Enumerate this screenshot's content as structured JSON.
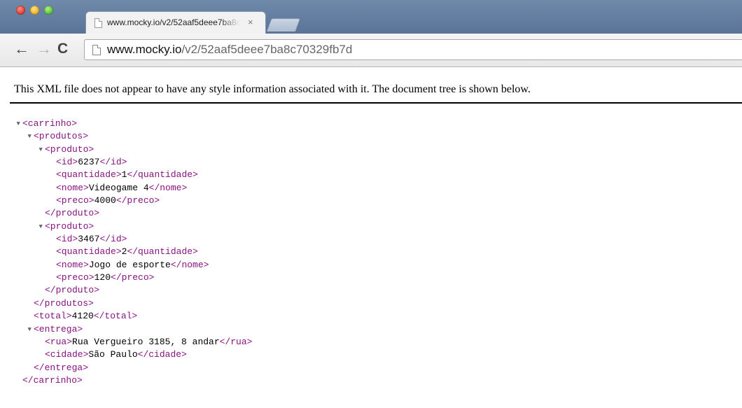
{
  "tab": {
    "title": "www.mocky.io/v2/52aaf5deee7ba8c70329fb7d",
    "close": "×"
  },
  "toolbar": {
    "back": "←",
    "forward": "→",
    "reload": "C"
  },
  "omnibox": {
    "host": "www.mocky.io",
    "path": "/v2/52aaf5deee7ba8c70329fb7d"
  },
  "notice": "This XML file does not appear to have any style information associated with it. The document tree is shown below.",
  "xml_lines": [
    {
      "depth": 0,
      "toggle": true,
      "open": "<carrinho>",
      "text": "",
      "close": ""
    },
    {
      "depth": 1,
      "toggle": true,
      "open": "<produtos>",
      "text": "",
      "close": ""
    },
    {
      "depth": 2,
      "toggle": true,
      "open": "<produto>",
      "text": "",
      "close": ""
    },
    {
      "depth": 3,
      "toggle": false,
      "open": "<id>",
      "text": "6237",
      "close": "</id>"
    },
    {
      "depth": 3,
      "toggle": false,
      "open": "<quantidade>",
      "text": "1",
      "close": "</quantidade>"
    },
    {
      "depth": 3,
      "toggle": false,
      "open": "<nome>",
      "text": "Videogame 4",
      "close": "</nome>"
    },
    {
      "depth": 3,
      "toggle": false,
      "open": "<preco>",
      "text": "4000",
      "close": "</preco>"
    },
    {
      "depth": 2,
      "toggle": false,
      "open": "</produto>",
      "text": "",
      "close": ""
    },
    {
      "depth": 2,
      "toggle": true,
      "open": "<produto>",
      "text": "",
      "close": ""
    },
    {
      "depth": 3,
      "toggle": false,
      "open": "<id>",
      "text": "3467",
      "close": "</id>"
    },
    {
      "depth": 3,
      "toggle": false,
      "open": "<quantidade>",
      "text": "2",
      "close": "</quantidade>"
    },
    {
      "depth": 3,
      "toggle": false,
      "open": "<nome>",
      "text": "Jogo de esporte",
      "close": "</nome>"
    },
    {
      "depth": 3,
      "toggle": false,
      "open": "<preco>",
      "text": "120",
      "close": "</preco>"
    },
    {
      "depth": 2,
      "toggle": false,
      "open": "</produto>",
      "text": "",
      "close": ""
    },
    {
      "depth": 1,
      "toggle": false,
      "open": "</produtos>",
      "text": "",
      "close": ""
    },
    {
      "depth": 1,
      "toggle": false,
      "open": "<total>",
      "text": "4120",
      "close": "</total>"
    },
    {
      "depth": 1,
      "toggle": true,
      "open": "<entrega>",
      "text": "",
      "close": ""
    },
    {
      "depth": 2,
      "toggle": false,
      "open": "<rua>",
      "text": "Rua Vergueiro 3185, 8 andar",
      "close": "</rua>"
    },
    {
      "depth": 2,
      "toggle": false,
      "open": "<cidade>",
      "text": "São Paulo",
      "close": "</cidade>"
    },
    {
      "depth": 1,
      "toggle": false,
      "open": "</entrega>",
      "text": "",
      "close": ""
    },
    {
      "depth": 0,
      "toggle": false,
      "open": "</carrinho>",
      "text": "",
      "close": ""
    }
  ]
}
